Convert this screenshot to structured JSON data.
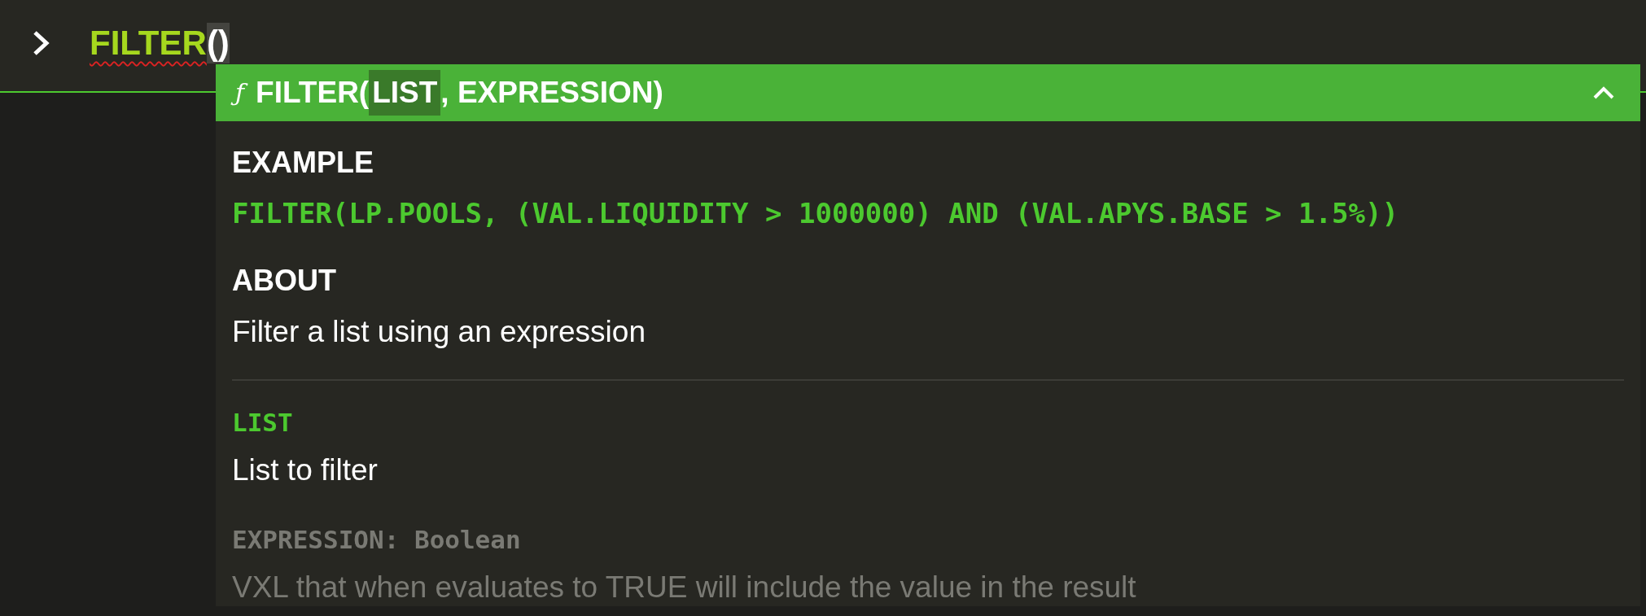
{
  "input": {
    "function": "FILTER",
    "args": "()",
    "error": true
  },
  "popup": {
    "icon": "ƒ",
    "expanded": true,
    "signature": [
      {
        "text": "FILTER(",
        "selected": false
      },
      {
        "text": "LIST",
        "selected": true
      },
      {
        "text": ", EXPRESSION)",
        "selected": false
      }
    ],
    "example_heading": "EXAMPLE",
    "example": "FILTER(LP.POOLS, (VAL.LIQUIDITY > 1000000) AND (VAL.APYS.BASE > 1.5%))",
    "about_heading": "ABOUT",
    "about": "Filter a list using an expression",
    "params": [
      {
        "name": "LIST",
        "description": "List to filter",
        "selected": true
      },
      {
        "name": "EXPRESSION: Boolean",
        "description": "VXL that when evaluates to TRUE will include the value in the result",
        "selected": false
      }
    ]
  }
}
